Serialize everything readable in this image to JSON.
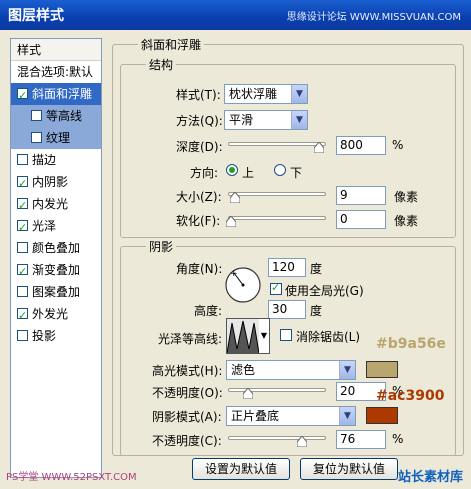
{
  "window": {
    "title": "图层样式",
    "watermark": "思缘设计论坛 WWW.MISSVUAN.COM"
  },
  "sidebar": {
    "header": "样式",
    "blend_options": "混合选项:默认",
    "items": [
      {
        "label": "斜面和浮雕",
        "checked": true
      },
      {
        "label": "等高线",
        "checked": false
      },
      {
        "label": "纹理",
        "checked": false
      },
      {
        "label": "描边",
        "checked": false
      },
      {
        "label": "内阴影",
        "checked": true
      },
      {
        "label": "内发光",
        "checked": true
      },
      {
        "label": "光泽",
        "checked": true
      },
      {
        "label": "颜色叠加",
        "checked": false
      },
      {
        "label": "渐变叠加",
        "checked": true
      },
      {
        "label": "图案叠加",
        "checked": false
      },
      {
        "label": "外发光",
        "checked": true
      },
      {
        "label": "投影",
        "checked": false
      }
    ]
  },
  "panel": {
    "title": "斜面和浮雕",
    "structure": {
      "title": "结构",
      "style_label": "样式(T):",
      "style_value": "枕状浮雕",
      "method_label": "方法(Q):",
      "method_value": "平滑",
      "depth_label": "深度(D):",
      "depth_value": "800",
      "depth_unit": "%",
      "direction_label": "方向:",
      "direction_up": "上",
      "direction_down": "下",
      "size_label": "大小(Z):",
      "size_value": "9",
      "size_unit": "像素",
      "soften_label": "软化(F):",
      "soften_value": "0",
      "soften_unit": "像素"
    },
    "shading": {
      "title": "阴影",
      "angle_label": "角度(N):",
      "angle_value": "120",
      "angle_unit": "度",
      "global_light_label": "使用全局光(G)",
      "altitude_label": "高度:",
      "altitude_value": "30",
      "altitude_unit": "度",
      "gloss_contour_label": "光泽等高线:",
      "antialias_label": "消除锯齿(L)",
      "highlight_mode_label": "高光模式(H):",
      "highlight_mode_value": "滤色",
      "highlight_opacity_label": "不透明度(O):",
      "highlight_opacity_value": "20",
      "highlight_opacity_unit": "%",
      "shadow_mode_label": "阴影模式(A):",
      "shadow_mode_value": "正片叠底",
      "shadow_opacity_label": "不透明度(C):",
      "shadow_opacity_value": "76",
      "shadow_opacity_unit": "%"
    },
    "buttons": {
      "set_default": "设置为默认值",
      "reset_default": "复位为默认值"
    }
  },
  "annotations": {
    "highlight_color": "#b9a56e",
    "shadow_color": "#ac3900"
  },
  "colors": {
    "highlight_swatch": "#b9a56e",
    "shadow_swatch": "#ac3900",
    "selected_bg": "#316ac5"
  },
  "levels": {
    "depth": 0.8,
    "size": 0.06,
    "soften": 0.0,
    "highlight_opacity": 0.2,
    "shadow_opacity": 0.76
  },
  "footer": {
    "watermark": "PS学堂 WWW.52PSXT.COM",
    "logo": "站长素材库"
  }
}
